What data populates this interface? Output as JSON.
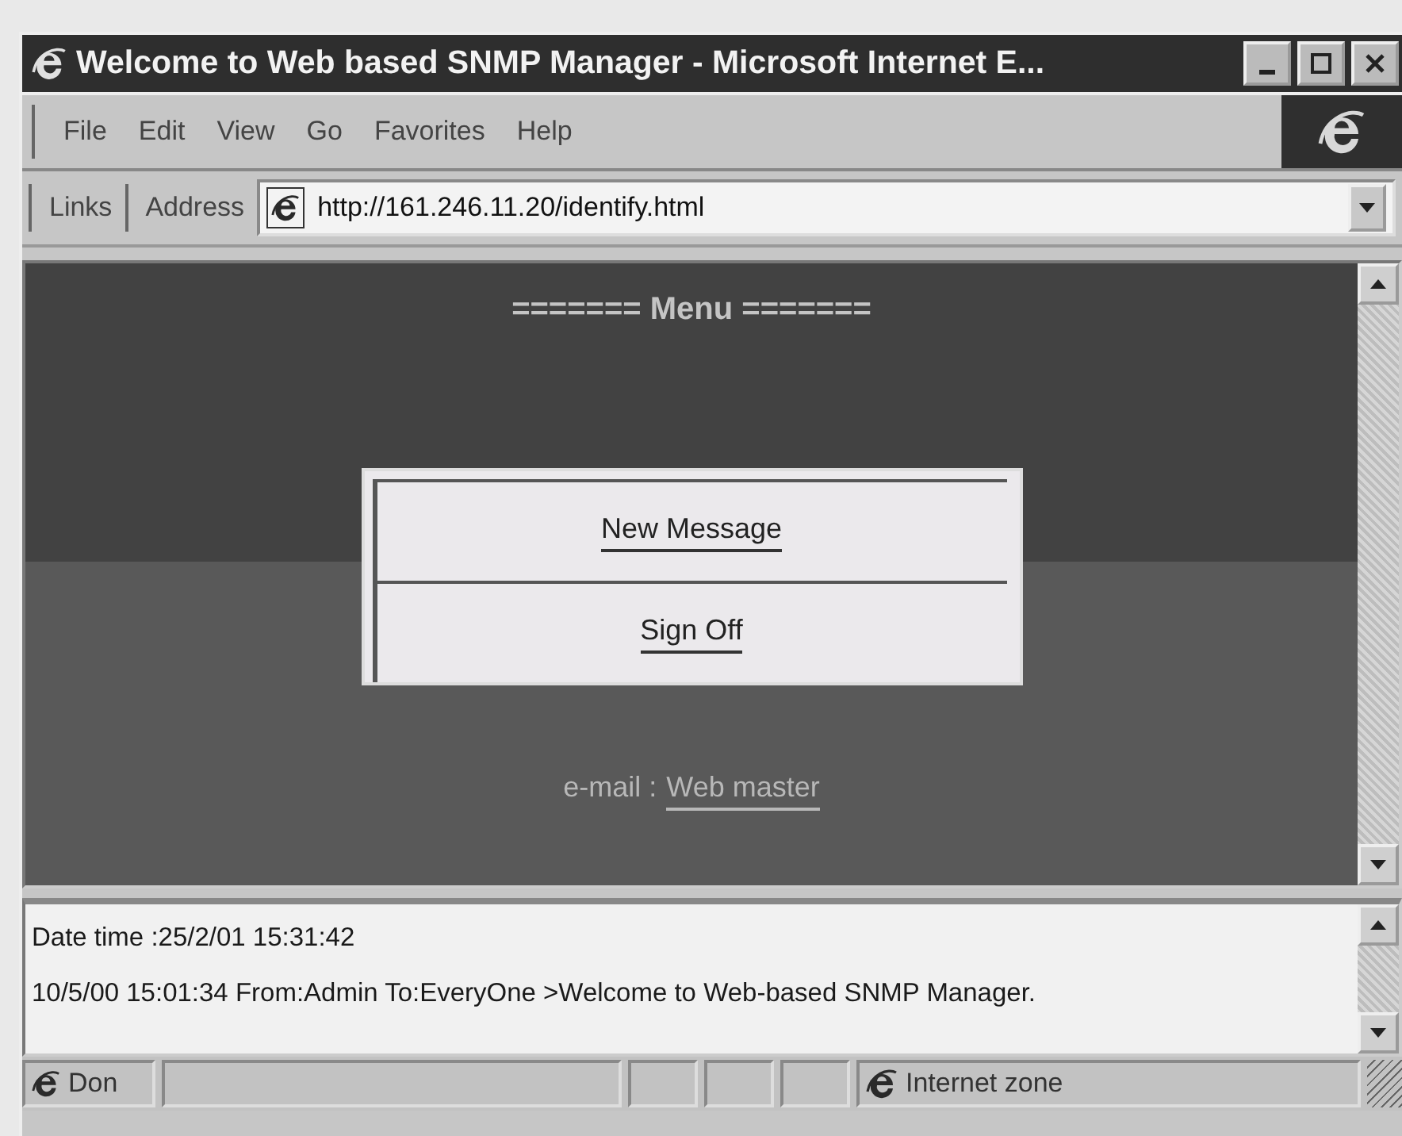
{
  "window": {
    "title": "Welcome to Web based SNMP Manager - Microsoft Internet E..."
  },
  "menu_bar": [
    "File",
    "Edit",
    "View",
    "Go",
    "Favorites",
    "Help"
  ],
  "address_bar": {
    "links_label": "Links",
    "address_label": "Address",
    "url": "http://161.246.11.20/identify.html"
  },
  "page": {
    "heading": "======= Menu =======",
    "menu_items": [
      {
        "label": "New Message"
      },
      {
        "label": "Sign Off"
      }
    ],
    "contact_label": "e-mail :",
    "contact_link": "Web master"
  },
  "message_frame": {
    "lines": [
      "Date time :25/2/01 15:31:42",
      "10/5/00 15:01:34 From:Admin To:EveryOne >Welcome to Web-based SNMP Manager."
    ]
  },
  "status_bar": {
    "text": "Don",
    "zone": "Internet zone"
  }
}
